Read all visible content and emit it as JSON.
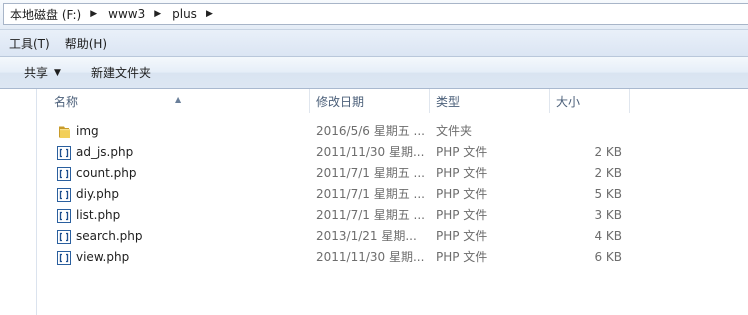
{
  "address": {
    "crumbs": [
      "本地磁盘 (F:)",
      "www3",
      "plus"
    ],
    "separator": "▶"
  },
  "menu": {
    "tools": "工具(T)",
    "help": "帮助(H)"
  },
  "toolbar": {
    "share": "共享",
    "share_arrow": "▼",
    "new_folder": "新建文件夹"
  },
  "columns": {
    "name": "名称",
    "date": "修改日期",
    "type": "类型",
    "size": "大小",
    "sort_indicator": "▲"
  },
  "files": [
    {
      "icon": "folder-icon",
      "name": "img",
      "date": "2016/5/6 星期五 ...",
      "type": "文件夹",
      "size": ""
    },
    {
      "icon": "php-file-icon",
      "name": "ad_js.php",
      "date": "2011/11/30 星期...",
      "type": "PHP 文件",
      "size": "2 KB"
    },
    {
      "icon": "php-file-icon",
      "name": "count.php",
      "date": "2011/7/1 星期五 ...",
      "type": "PHP 文件",
      "size": "2 KB"
    },
    {
      "icon": "php-file-icon",
      "name": "diy.php",
      "date": "2011/7/1 星期五 ...",
      "type": "PHP 文件",
      "size": "5 KB"
    },
    {
      "icon": "php-file-icon",
      "name": "list.php",
      "date": "2011/7/1 星期五 ...",
      "type": "PHP 文件",
      "size": "3 KB"
    },
    {
      "icon": "php-file-icon",
      "name": "search.php",
      "date": "2013/1/21 星期...",
      "type": "PHP 文件",
      "size": "4 KB"
    },
    {
      "icon": "php-file-icon",
      "name": "view.php",
      "date": "2011/11/30 星期...",
      "type": "PHP 文件",
      "size": "6 KB"
    }
  ]
}
